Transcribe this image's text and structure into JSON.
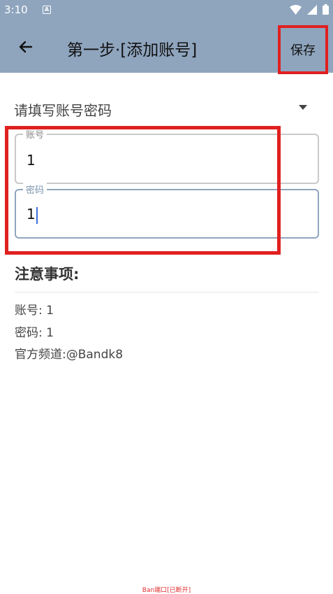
{
  "status_bar": {
    "time": "3:10",
    "notification_glyph": "A"
  },
  "toolbar": {
    "title": "第一步·[添加账号]",
    "save_label": "保存"
  },
  "spinner": {
    "selected": "请填写账号密码"
  },
  "fields": {
    "account": {
      "label": "账号",
      "value": "1"
    },
    "password": {
      "label": "密码",
      "value": "1"
    }
  },
  "notes": {
    "title": "注意事项:",
    "lines": [
      "账号: 1",
      "密码: 1",
      "官方频道:@Bandk8"
    ]
  },
  "footer": {
    "text": "Ban端口[已断开]"
  },
  "colors": {
    "appbar": "#8fa5be",
    "highlight": "#e02020",
    "accent": "#7d95b0"
  }
}
